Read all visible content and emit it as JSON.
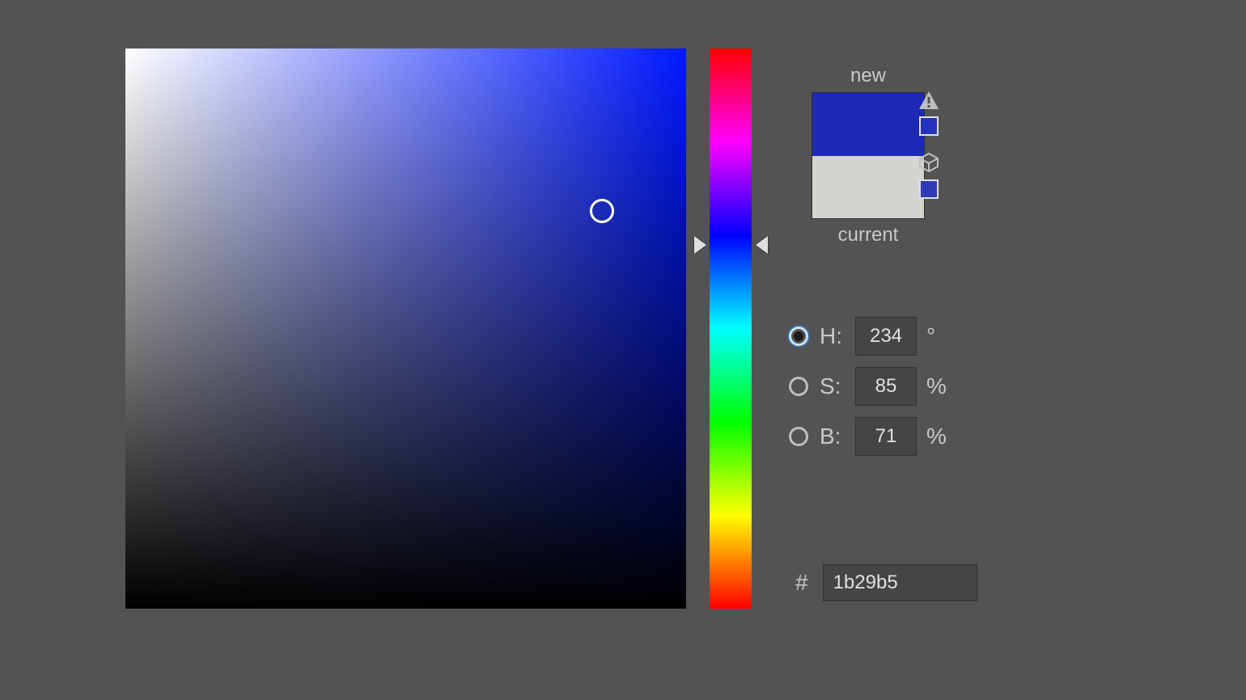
{
  "hue_deg": 234,
  "saturation_pct": 85,
  "brightness_pct": 71,
  "hex": "1b29b5",
  "labels": {
    "new": "new",
    "current": "current",
    "H": "H:",
    "S": "S:",
    "B": "B:",
    "deg": "°",
    "pct": "%",
    "hash": "#"
  },
  "swatch": {
    "new_color": "#1b29b5",
    "current_color": "#d6d4ce",
    "gamut_warning_new": "#2532bd",
    "gamut_warning_current": "#2f3bb8"
  },
  "selected_channel": "H"
}
